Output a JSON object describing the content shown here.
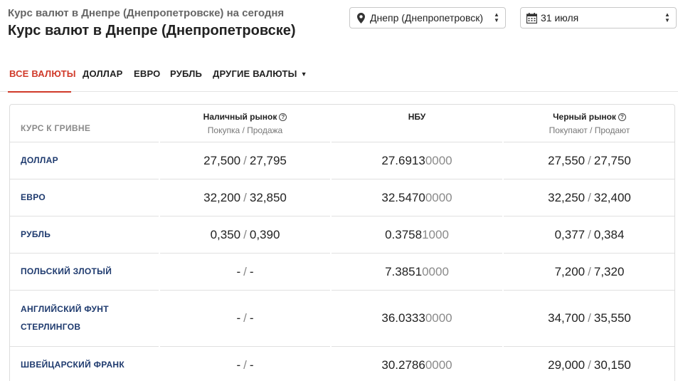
{
  "header": {
    "subtitle": "Курс валют в Днепре (Днепропетровске) на сегодня",
    "title": "Курс валют в Днепре (Днепропетровске)"
  },
  "selectors": {
    "city": "Днепр (Днепропетровск)",
    "date": "31 июля"
  },
  "tabs": [
    {
      "label": "ВСЕ ВАЛЮТЫ",
      "active": true
    },
    {
      "label": "ДОЛЛАР"
    },
    {
      "label": "ЕВРО"
    },
    {
      "label": "РУБЛЬ"
    },
    {
      "label": "ДРУГИЕ ВАЛЮТЫ"
    }
  ],
  "table": {
    "corner_label": "КУРС К ГРИВНЕ",
    "columns": [
      {
        "title": "Наличный рынок",
        "sub": "Покупка / Продажа",
        "help": true
      },
      {
        "title": "НБУ",
        "sub": ""
      },
      {
        "title": "Черный рынок",
        "sub": "Покупают / Продают",
        "help": true
      }
    ],
    "rows": [
      {
        "name": "ДОЛЛАР",
        "cash_buy": "27,500",
        "cash_sell": "27,795",
        "nbu_main": "27.6913",
        "nbu_tail": "0000",
        "black_buy": "27,550",
        "black_sell": "27,750"
      },
      {
        "name": "ЕВРО",
        "cash_buy": "32,200",
        "cash_sell": "32,850",
        "nbu_main": "32.5470",
        "nbu_tail": "0000",
        "black_buy": "32,250",
        "black_sell": "32,400"
      },
      {
        "name": "РУБЛЬ",
        "cash_buy": "0,350",
        "cash_sell": "0,390",
        "nbu_main": "0.3758",
        "nbu_tail": "1000",
        "black_buy": "0,377",
        "black_sell": "0,384"
      },
      {
        "name": "ПОЛЬСКИЙ ЗЛОТЫЙ",
        "cash_buy": "-",
        "cash_sell": "-",
        "nbu_main": "7.3851",
        "nbu_tail": "0000",
        "black_buy": "7,200",
        "black_sell": "7,320"
      },
      {
        "name": "АНГЛИЙСКИЙ ФУНТ СТЕРЛИНГОВ",
        "name_line1": "АНГЛИЙСКИЙ ФУНТ",
        "name_line2": "СТЕРЛИНГОВ",
        "cash_buy": "-",
        "cash_sell": "-",
        "nbu_main": "36.0333",
        "nbu_tail": "0000",
        "black_buy": "34,700",
        "black_sell": "35,550"
      },
      {
        "name": "ШВЕЙЦАРСКИЙ ФРАНК",
        "cash_buy": "-",
        "cash_sell": "-",
        "nbu_main": "30.2786",
        "nbu_tail": "0000",
        "black_buy": "29,000",
        "black_sell": "30,150"
      }
    ],
    "separator": "/"
  }
}
